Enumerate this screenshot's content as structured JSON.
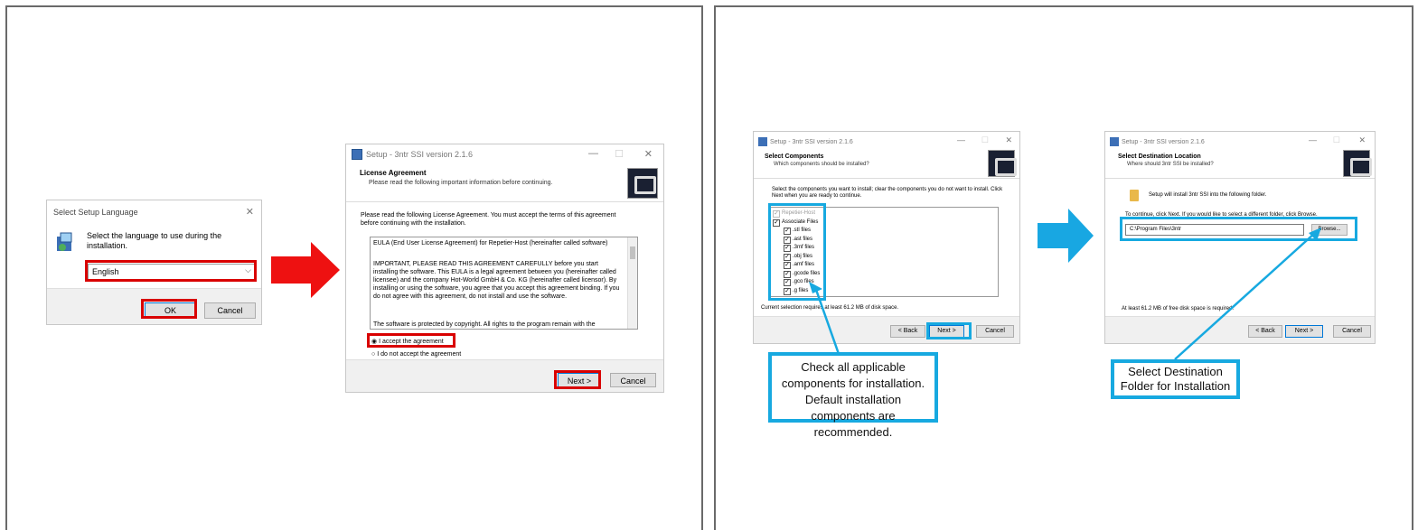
{
  "lang_dialog": {
    "title": "Select Setup Language",
    "close": "✕",
    "message": "Select the language to use during the installation.",
    "selected_language": "English",
    "ok_label": "OK",
    "cancel_label": "Cancel"
  },
  "license_dialog": {
    "title": "Setup - 3ntr SSI version 2.1.6",
    "min": "—",
    "max": "☐",
    "close": "✕",
    "header_title": "License Agreement",
    "header_sub": "Please read the following important information before continuing.",
    "instructions": "Please read the following License Agreement. You must accept the terms of this agreement before continuing with the installation.",
    "text_p1": "EULA (End User License Agreement) for Repetier-Host (hereinafter called software)",
    "text_p2": "IMPORTANT, PLEASE READ THIS AGREEMENT CAREFULLY before you start installing the software. This EULA is a legal agreement between you (hereinafter called licensee) and the company Hot-World GmbH & Co. KG (hereinafter called licensor). By installing or using the software, you agree that you accept this agreement binding. If you do not agree with this agreement, do not install and use the software.",
    "text_p3": "The software is protected by copyright. All rights to the program remain with the",
    "accept_label": "I accept the agreement",
    "decline_label": "I do not accept the agreement",
    "next_label": "Next >",
    "cancel_label": "Cancel"
  },
  "components_dialog": {
    "title": "Setup - 3ntr SSI version 2.1.6",
    "min": "—",
    "max": "☐",
    "close": "✕",
    "header_title": "Select Components",
    "header_sub": "Which components should be installed?",
    "instructions": "Select the components you want to install; clear the components you do not want to install. Click Next when you are ready to continue.",
    "components": [
      {
        "label": "Repetier-Host",
        "checked": true,
        "disabled": true,
        "indent": 0
      },
      {
        "label": "Associate Files",
        "checked": true,
        "disabled": false,
        "indent": 0
      },
      {
        "label": ".stl files",
        "checked": true,
        "disabled": false,
        "indent": 1
      },
      {
        "label": ".ast files",
        "checked": true,
        "disabled": false,
        "indent": 1
      },
      {
        "label": ".3mf files",
        "checked": true,
        "disabled": false,
        "indent": 1
      },
      {
        "label": ".obj files",
        "checked": true,
        "disabled": false,
        "indent": 1
      },
      {
        "label": ".amf files",
        "checked": true,
        "disabled": false,
        "indent": 1
      },
      {
        "label": ".gcode files",
        "checked": true,
        "disabled": false,
        "indent": 1
      },
      {
        "label": ".gco files",
        "checked": true,
        "disabled": false,
        "indent": 1
      },
      {
        "label": ".g files",
        "checked": true,
        "disabled": false,
        "indent": 1
      }
    ],
    "space_note": "Current selection requires at least 61.2 MB of disk space.",
    "back_label": "< Back",
    "next_label": "Next >",
    "cancel_label": "Cancel"
  },
  "destination_dialog": {
    "title": "Setup - 3ntr SSI version 2.1.6",
    "min": "—",
    "max": "☐",
    "close": "✕",
    "header_title": "Select Destination Location",
    "header_sub": "Where should 3ntr SSI be installed?",
    "install_msg": "Setup will install 3ntr SSI into the following folder.",
    "continue_msg": "To continue, click Next. If you would like to select a different folder, click Browse.",
    "path_value": "C:\\Program Files\\3ntr",
    "browse_label": "Browse...",
    "space_note": "At least 61.2 MB of free disk space is required.",
    "back_label": "< Back",
    "next_label": "Next >",
    "cancel_label": "Cancel"
  },
  "callouts": {
    "components": "Check all applicable components for installation. Default installation components are recommended.",
    "destination": "Select Destination Folder for Installation"
  },
  "colors": {
    "highlight_red": "#d90000",
    "highlight_blue": "#17a9e0",
    "arrow_red": "#ee1111",
    "arrow_blue": "#18a7e2"
  }
}
